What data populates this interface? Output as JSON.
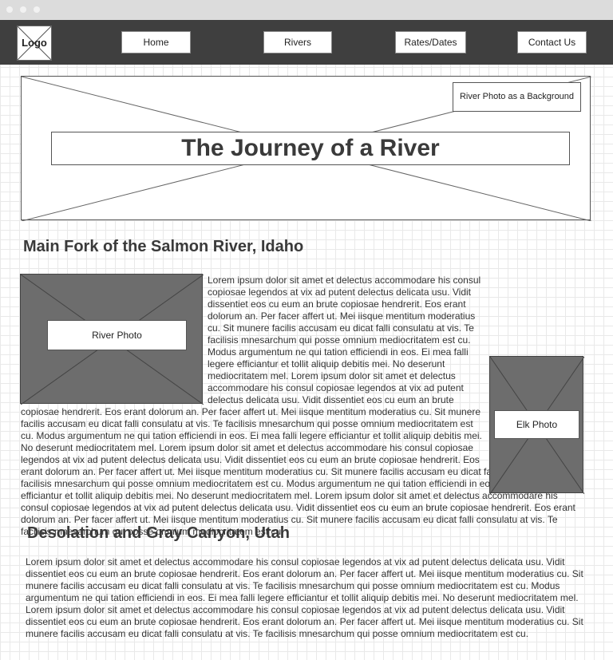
{
  "window": {
    "controls": [
      "close",
      "minimize",
      "maximize"
    ]
  },
  "nav": {
    "logo": "Logo",
    "items": [
      "Home",
      "Rivers",
      "Rates/Dates",
      "Contact Us"
    ]
  },
  "hero": {
    "tag": "River Photo as a Background",
    "title": "The Journey of a River"
  },
  "section1": {
    "heading": "Main Fork of the Salmon River, Idaho",
    "river_photo_label": "River Photo",
    "elk_photo_label": "Elk Photo",
    "body": "Lorem ipsum dolor sit amet et delectus accommodare his consul copiosae legendos at vix ad putent delectus delicata usu. Vidit dissentiet eos cu eum an brute copiosae hendrerit. Eos erant dolorum an. Per facer affert ut. Mei iisque mentitum moderatius cu. Sit munere facilis accusam eu dicat falli consulatu at vis. Te facilisis mnesarchum qui posse omnium mediocritatem est cu. Modus argumentum ne qui tation efficiendi in eos. Ei mea falli legere efficiantur et tollit aliquip debitis mei. No deserunt mediocritatem mel. Lorem ipsum dolor sit amet et delectus accommodare his consul copiosae legendos at vix ad putent delectus delicata usu. Vidit dissentiet eos cu eum an brute copiosae hendrerit. Eos erant dolorum an. Per facer affert ut. Mei iisque mentitum moderatius cu. Sit munere facilis accusam eu dicat falli consulatu at vis. Te facilisis mnesarchum qui posse omnium mediocritatem est cu. Modus argumentum ne qui tation efficiendi in eos. Ei mea falli legere efficiantur et tollit aliquip debitis mei. No deserunt mediocritatem mel. Lorem ipsum dolor sit amet et delectus accommodare his consul copiosae legendos at vix ad putent delectus delicata usu. Vidit dissentiet eos cu eum an brute copiosae hendrerit. Eos erant dolorum an. Per facer affert ut. Mei iisque mentitum moderatius cu. Sit munere facilis accusam eu dicat falli consulatu at vis. Te facilisis mnesarchum qui posse omnium mediocritatem est cu. Modus argumentum ne qui tation efficiendi in eos. Ei mea falli legere efficiantur et tollit aliquip debitis mei. No deserunt mediocritatem mel. Lorem ipsum dolor sit amet et delectus accommodare his consul copiosae legendos at vix ad putent delectus delicata usu. Vidit dissentiet eos cu eum an brute copiosae hendrerit. Eos erant dolorum an. Per facer affert ut. Mei iisque mentitum moderatius cu. Sit munere facilis accusam eu dicat falli consulatu at vis. Te facilisis mnesarchum qui posse omnium mediocritatem est cu."
  },
  "section2": {
    "heading": "Desolation and Gray Canyon, Utah",
    "body": "Lorem ipsum dolor sit amet et delectus accommodare his consul copiosae legendos at vix ad putent delectus delicata usu. Vidit dissentiet eos cu eum an brute copiosae hendrerit. Eos erant dolorum an. Per facer affert ut. Mei iisque mentitum moderatius cu. Sit munere facilis accusam eu dicat falli consulatu at vis. Te facilisis mnesarchum qui posse omnium mediocritatem est cu. Modus argumentum ne qui tation efficiendi in eos. Ei mea falli legere efficiantur et tollit aliquip debitis mei. No deserunt mediocritatem mel. Lorem ipsum dolor sit amet et delectus accommodare his consul copiosae legendos at vix ad putent delectus delicata usu. Vidit dissentiet eos cu eum an brute copiosae hendrerit. Eos erant dolorum an. Per facer affert ut. Mei iisque mentitum moderatius cu. Sit munere facilis accusam eu dicat falli consulatu at vis. Te facilisis mnesarchum qui posse omnium mediocritatem est cu."
  }
}
